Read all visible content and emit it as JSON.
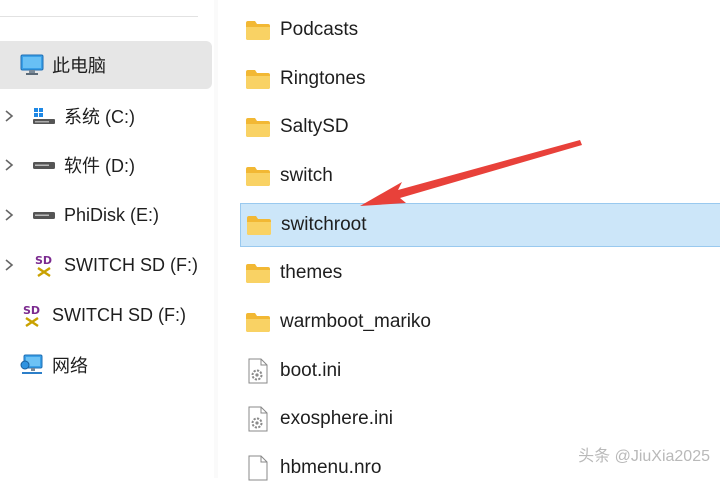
{
  "sidebar": {
    "items": [
      {
        "label": "此电脑",
        "icon": "monitor-icon",
        "selected": true,
        "chevron": false
      },
      {
        "label": "系统 (C:)",
        "icon": "windows-drive-icon",
        "chevron": true
      },
      {
        "label": "软件 (D:)",
        "icon": "drive-icon",
        "chevron": true
      },
      {
        "label": "PhiDisk (E:)",
        "icon": "drive-icon",
        "chevron": true
      },
      {
        "label": "SWITCH SD (F:)",
        "icon": "sd-card-icon",
        "chevron": true
      },
      {
        "label": "SWITCH SD (F:)",
        "icon": "sd-card-icon",
        "chevron": false
      },
      {
        "label": "网络",
        "icon": "network-icon",
        "chevron": false
      }
    ]
  },
  "files": [
    {
      "name": "Podcasts",
      "type": "folder"
    },
    {
      "name": "Ringtones",
      "type": "folder"
    },
    {
      "name": "SaltySD",
      "type": "folder"
    },
    {
      "name": "switch",
      "type": "folder"
    },
    {
      "name": "switchroot",
      "type": "folder",
      "selected": true
    },
    {
      "name": "themes",
      "type": "folder"
    },
    {
      "name": "warmboot_mariko",
      "type": "folder"
    },
    {
      "name": "boot.ini",
      "type": "ini"
    },
    {
      "name": "exosphere.ini",
      "type": "ini"
    },
    {
      "name": "hbmenu.nro",
      "type": "file"
    }
  ],
  "watermark": {
    "text": "头条 @JiuXia2025"
  },
  "colors": {
    "selection_bg": "#cce6f9",
    "selection_border": "#99c9ef",
    "folder": "#f7c948",
    "annotation_arrow": "#e8413a"
  }
}
